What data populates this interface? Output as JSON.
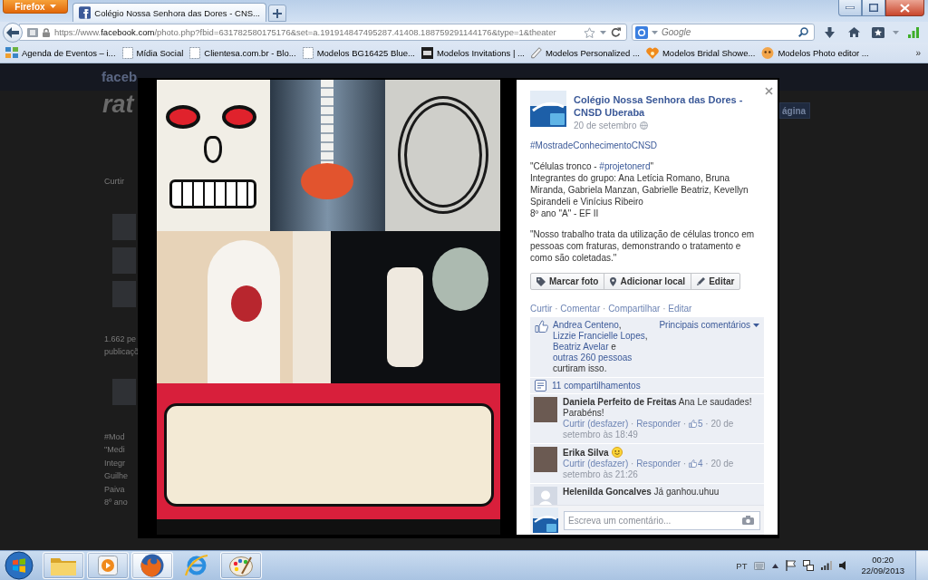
{
  "browser": {
    "menu_button": "Firefox",
    "tabs": [
      {
        "title": "Colégio Nossa Senhora das Dores - CNS...",
        "selected": true
      }
    ],
    "address": "https://www.**facebook.com**/photo.php?fbid=631782580175176&set=a.191914847495287.41408.188759291144176&type=1&theater",
    "search": {
      "placeholder": "Google"
    },
    "bookmarks": [
      {
        "label": "Agenda de Eventos – i...",
        "kind": "grid"
      },
      {
        "label": "Mídia Social",
        "kind": "blank"
      },
      {
        "label": "Clientesa.com.br - Blo...",
        "kind": "blank"
      },
      {
        "label": "Modelos BG16425 Blue...",
        "kind": "blank"
      },
      {
        "label": "Modelos Invitations | ...",
        "kind": "box"
      },
      {
        "label": "Modelos Personalized ...",
        "kind": "pen"
      },
      {
        "label": "Modelos Bridal Showe...",
        "kind": "heart"
      },
      {
        "label": "Modelos Photo editor ...",
        "kind": "face"
      }
    ],
    "bookmarks_more": "»"
  },
  "background_page": {
    "logo": "faceb",
    "heading": "rat",
    "items": [
      {
        "kind": "text",
        "text": "Curtir"
      },
      {
        "kind": "avatar"
      },
      {
        "kind": "avatar"
      },
      {
        "kind": "avatar"
      },
      {
        "kind": "text",
        "text": "1.662 pe"
      },
      {
        "kind": "text",
        "text": "publicaçõ"
      },
      {
        "kind": "avatar"
      },
      {
        "kind": "text",
        "text": "#Mod"
      },
      {
        "kind": "text",
        "text": "\"Medi"
      },
      {
        "kind": "text",
        "text": "Integr"
      },
      {
        "kind": "text",
        "text": "Guilhe"
      },
      {
        "kind": "text",
        "text": "Paiva"
      },
      {
        "kind": "text",
        "text": "8º ano"
      }
    ],
    "button": "ágina"
  },
  "post": {
    "author": "Colégio Nossa Senhora das Dores - CNSD Uberaba",
    "date": "20 de setembro",
    "caption": [
      [
        [
          {
            "kind": "link",
            "text": "#MostradeConhecimentoCNSD"
          }
        ]
      ],
      [
        [
          {
            "kind": "text",
            "text": "\"Células tronco - "
          },
          {
            "kind": "link",
            "text": "#projetonerd"
          },
          {
            "kind": "text",
            "text": "\""
          }
        ],
        [
          {
            "kind": "text",
            "text": "Integrantes do grupo: Ana Letícia Romano, Bruna Miranda, Gabriela Manzan, Gabrielle Beatriz, Kevellyn Spirandeli e Vinícius Ribeiro"
          }
        ],
        [
          {
            "kind": "text",
            "text": "8º ano \"A\" - EF II"
          }
        ]
      ],
      [
        [
          {
            "kind": "text",
            "text": "\"Nosso trabalho trata da utilização de células tronco em pessoas com fraturas, demonstrando o tratamento e como são coletadas.\""
          }
        ]
      ]
    ],
    "photo_buttons": [
      {
        "label": "Marcar foto",
        "kind": "tag"
      },
      {
        "label": "Adicionar local",
        "kind": "pin"
      },
      {
        "label": "Editar",
        "kind": "pencil"
      }
    ],
    "actions": [
      {
        "kind": "link",
        "text": "Curtir"
      },
      {
        "kind": "text",
        "text": " · "
      },
      {
        "kind": "link",
        "text": "Comentar"
      },
      {
        "kind": "text",
        "text": " · "
      },
      {
        "kind": "link",
        "text": "Compartilhar"
      },
      {
        "kind": "text",
        "text": " · "
      },
      {
        "kind": "link",
        "text": "Editar"
      }
    ],
    "likes": [
      {
        "kind": "link",
        "text": "Andrea Centeno"
      },
      {
        "kind": "text",
        "text": ", "
      },
      {
        "kind": "link",
        "text": "Lizzie Francielle Lopes"
      },
      {
        "kind": "text",
        "text": ", "
      },
      {
        "kind": "link",
        "text": "Beatriz Avelar"
      },
      {
        "kind": "text",
        "text": " e "
      },
      {
        "kind": "link",
        "text": "outras 260 pessoas"
      },
      {
        "kind": "text",
        "text": " curtiram isso."
      }
    ],
    "sort": "Principais comentários",
    "shares": "11 compartilhamentos",
    "comments": [
      {
        "author": "Daniela Perfeito de Freitas",
        "text": "Ana Le saudades! Parabéns!",
        "smiley": false,
        "avatar": {
          "kind": "photo"
        },
        "meta": [
          {
            "kind": "link",
            "text": "Curtir (desfazer)"
          },
          {
            "kind": "text",
            "text": " · "
          },
          {
            "kind": "link",
            "text": "Responder"
          },
          {
            "kind": "text",
            "text": " · "
          },
          {
            "kind": "like",
            "text": "5"
          },
          {
            "kind": "text",
            "text": " · 20 de setembro às 18:49"
          }
        ]
      },
      {
        "author": "Erika Silva",
        "smiley": true,
        "avatar": {
          "kind": "photo"
        },
        "meta": [
          {
            "kind": "link",
            "text": "Curtir (desfazer)"
          },
          {
            "kind": "text",
            "text": " · "
          },
          {
            "kind": "link",
            "text": "Responder"
          },
          {
            "kind": "text",
            "text": " · "
          },
          {
            "kind": "like",
            "text": "4"
          },
          {
            "kind": "text",
            "text": " · 20 de setembro às 21:26"
          }
        ]
      },
      {
        "author": "Helenilda Goncalves",
        "text": "Já ganhou.uhuu",
        "smiley": false,
        "avatar": {
          "kind": "silhouette"
        }
      }
    ],
    "composer": {
      "placeholder": "Escreva um comentário..."
    }
  },
  "taskbar": {
    "apps": [
      {
        "kind": "explorer",
        "running": true,
        "selected": false
      },
      {
        "kind": "media",
        "running": true,
        "selected": false
      },
      {
        "kind": "firefox",
        "running": true,
        "selected": true
      },
      {
        "kind": "ie",
        "running": false,
        "selected": false
      },
      {
        "kind": "paint",
        "running": true,
        "selected": false
      }
    ],
    "language": "PT",
    "time": "00:20",
    "date": "22/09/2013"
  }
}
